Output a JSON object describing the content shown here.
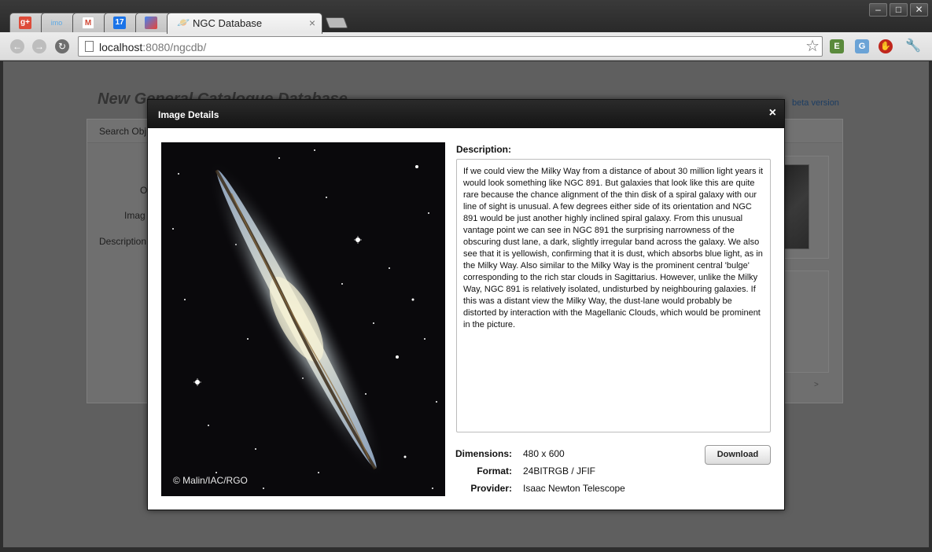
{
  "browser": {
    "tabs": [
      {
        "icon": "google-plus-icon",
        "label": "g+",
        "color": "#dd4b39"
      },
      {
        "icon": "imo-icon",
        "label": "imo",
        "color": "#5aa9e6"
      },
      {
        "icon": "gmail-icon",
        "label": "M",
        "color": "#d14836"
      },
      {
        "icon": "calendar-icon",
        "label": "17",
        "color": "#1a73e8"
      },
      {
        "icon": "chrome-page-icon",
        "label": "",
        "color": "#4285f4"
      },
      {
        "icon": "saturn-icon",
        "label": "NGC Database",
        "color": "#4a6fa5"
      }
    ],
    "active_tab_title": "NGC Database",
    "url_host": "localhost",
    "url_path": ":8080/ngcdb/"
  },
  "page": {
    "site_title": "New General Catalogue Database",
    "beta_label": "beta version",
    "tab_label": "Search Obj",
    "form_labels": [
      "O",
      "Imag",
      "Description"
    ]
  },
  "modal": {
    "title": "Image Details",
    "close_label": "×",
    "image_credit": "© Malin/IAC/RGO",
    "description_label": "Description:",
    "description": "If we could view the Milky Way from a distance of about 30 million light years it would look something like NGC 891. But galaxies that look like this are quite rare because the chance alignment of the thin disk of a spiral galaxy with our line of sight is unusual. A few degrees either side of its orientation and NGC 891 would be just another highly inclined spiral galaxy. From this unusual vantage point we can see in NGC 891 the surprising narrowness of the obscuring dust lane, a dark, slightly irregular band across the galaxy. We also see that it is yellowish, confirming that it is dust, which absorbs blue light, as in the Milky Way. Also similar to the Milky Way is the prominent central 'bulge' corresponding to the rich star clouds in Sagittarius. However, unlike the Milky Way, NGC 891 is relatively isolated, undisturbed by neighbouring galaxies. If this was a distant view the Milky Way, the dust-lane would probably be distorted by interaction with the Magellanic Clouds, which would be prominent in the picture.",
    "dimensions_label": "Dimensions:",
    "dimensions_value": "480 x 600",
    "format_label": "Format:",
    "format_value": "24BITRGB / JFIF",
    "provider_label": "Provider:",
    "provider_value": "Isaac Newton Telescope",
    "download_label": "Download"
  }
}
